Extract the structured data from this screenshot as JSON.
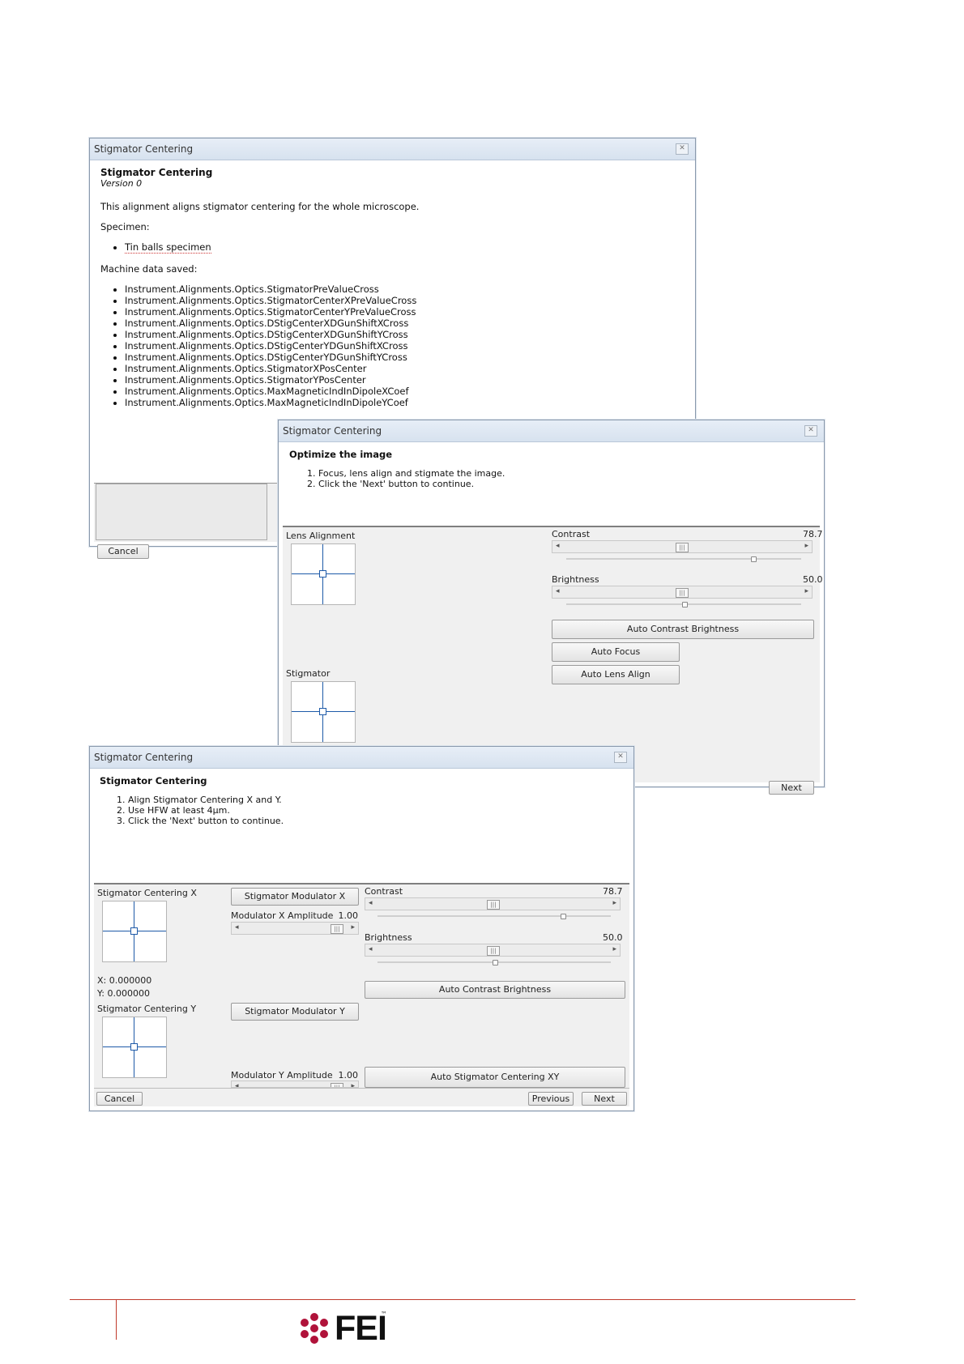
{
  "dialog1": {
    "title": "Stigmator Centering",
    "heading": "Stigmator Centering",
    "version": "Version 0",
    "description": "This alignment aligns stigmator centering for the whole microscope.",
    "specimen_label": "Specimen:",
    "specimen_items": [
      "Tin balls specimen"
    ],
    "machine_label": "Machine data saved:",
    "machine_items": [
      "Instrument.Alignments.Optics.StigmatorPreValueCross",
      "Instrument.Alignments.Optics.StigmatorCenterXPreValueCross",
      "Instrument.Alignments.Optics.StigmatorCenterYPreValueCross",
      "Instrument.Alignments.Optics.DStigCenterXDGunShiftXCross",
      "Instrument.Alignments.Optics.DStigCenterXDGunShiftYCross",
      "Instrument.Alignments.Optics.DStigCenterYDGunShiftXCross",
      "Instrument.Alignments.Optics.DStigCenterYDGunShiftYCross",
      "Instrument.Alignments.Optics.StigmatorXPosCenter",
      "Instrument.Alignments.Optics.StigmatorYPosCenter",
      "Instrument.Alignments.Optics.MaxMagneticIndInDipoleXCoef",
      "Instrument.Alignments.Optics.MaxMagneticIndInDipoleYCoef"
    ],
    "cancel": "Cancel"
  },
  "dialog2": {
    "title": "Stigmator Centering",
    "heading": "Optimize the image",
    "steps": [
      "Focus, lens align and stigmate the image.",
      "Click the 'Next' button to continue."
    ],
    "lens_alignment": "Lens Alignment",
    "stigmator": "Stigmator",
    "contrast_label": "Contrast",
    "contrast_value": "78.7",
    "brightness_label": "Brightness",
    "brightness_value": "50.0",
    "auto_contrast_brightness": "Auto Contrast Brightness",
    "auto_focus": "Auto Focus",
    "auto_lens_align": "Auto Lens Align",
    "next": "Next"
  },
  "dialog3": {
    "title": "Stigmator Centering",
    "heading": "Stigmator Centering",
    "steps": [
      "Align Stigmator Centering X and Y.",
      "Use HFW at least 4µm.",
      "Click the 'Next' button to continue."
    ],
    "centering_x": "Stigmator Centering X",
    "centering_y": "Stigmator Centering Y",
    "x_value": "X: 0.000000",
    "y_value": "Y: 0.000000",
    "modulator_x": "Stigmator Modulator X",
    "modulator_y": "Stigmator Modulator Y",
    "mod_x_amp_label": "Modulator X Amplitude",
    "mod_x_amp_value": "1.00",
    "mod_y_amp_label": "Modulator Y Amplitude",
    "mod_y_amp_value": "1.00",
    "contrast_label": "Contrast",
    "contrast_value": "78.7",
    "brightness_label": "Brightness",
    "brightness_value": "50.0",
    "auto_contrast_brightness": "Auto Contrast Brightness",
    "auto_stigmator_xy": "Auto Stigmator Centering XY",
    "cancel": "Cancel",
    "previous": "Previous",
    "next": "Next"
  },
  "footer": {
    "logo_text": "FEI",
    "trademark": "™",
    "rule_color": "#c0392b",
    "logo_color": "#b0123a"
  }
}
